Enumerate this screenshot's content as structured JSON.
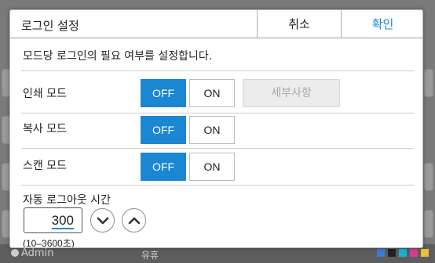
{
  "background": {
    "user_label": "Admin",
    "mid_label": "유휴",
    "ink_colors": [
      "#3a7bd5",
      "#222222",
      "#18b0d8",
      "#d43f8d",
      "#e8c23a"
    ]
  },
  "dialog": {
    "title": "로그인 설정",
    "cancel_label": "취소",
    "ok_label": "확인",
    "description": "모드당 로그인의 필요 여부를 설정합니다.",
    "rows": [
      {
        "label": "인쇄 모드",
        "off_label": "OFF",
        "on_label": "ON",
        "selected": "OFF",
        "details_label": "세부사항"
      },
      {
        "label": "복사 모드",
        "off_label": "OFF",
        "on_label": "ON",
        "selected": "OFF"
      },
      {
        "label": "스캔 모드",
        "off_label": "OFF",
        "on_label": "ON",
        "selected": "OFF"
      }
    ],
    "timeout": {
      "label": "자동 로그아웃 시간",
      "value": "300",
      "range": "(10–3600초)"
    }
  },
  "colors": {
    "accent": "#1b87d3"
  }
}
